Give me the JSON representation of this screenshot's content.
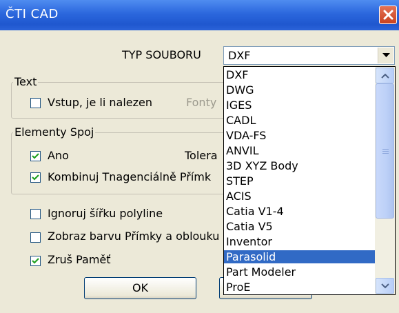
{
  "window": {
    "title": "ČTI CAD",
    "close_icon": "close-icon"
  },
  "file_type": {
    "label": "TYP SOUBORU",
    "value": "DXF"
  },
  "text_group": {
    "legend": "Text",
    "checkbox_label": "Vstup, je li nalezen",
    "checked": false,
    "fonts_label": "Fonty"
  },
  "elements_group": {
    "legend": "Elementy Spoj",
    "ano_label": "Ano",
    "ano_checked": true,
    "tolerance_label": "Tolera",
    "combine_label": "Kombinuj Tnagenciálně Přímk",
    "combine_checked": true
  },
  "options": {
    "ignore_width_label": "Ignoruj šířku polyline",
    "ignore_width_checked": false,
    "show_color_label": "Zobraz barvu Přímky a oblouku",
    "show_color_checked": false,
    "clear_memory_label": "Zruš Paměť",
    "clear_memory_checked": true
  },
  "buttons": {
    "ok": "OK"
  },
  "dropdown": {
    "items": [
      "DXF",
      "DWG",
      "IGES",
      "CADL",
      "VDA-FS",
      "ANVIL",
      "3D XYZ Body",
      "STEP",
      "ACIS",
      "Catia V1-4",
      "Catia V5",
      "Inventor",
      "Parasolid",
      "Part Modeler",
      "ProE"
    ],
    "selected": "Parasolid"
  },
  "colors": {
    "title_bar": "#2b67dd",
    "selection": "#316ac5",
    "dialog_bg": "#ece9d8"
  }
}
